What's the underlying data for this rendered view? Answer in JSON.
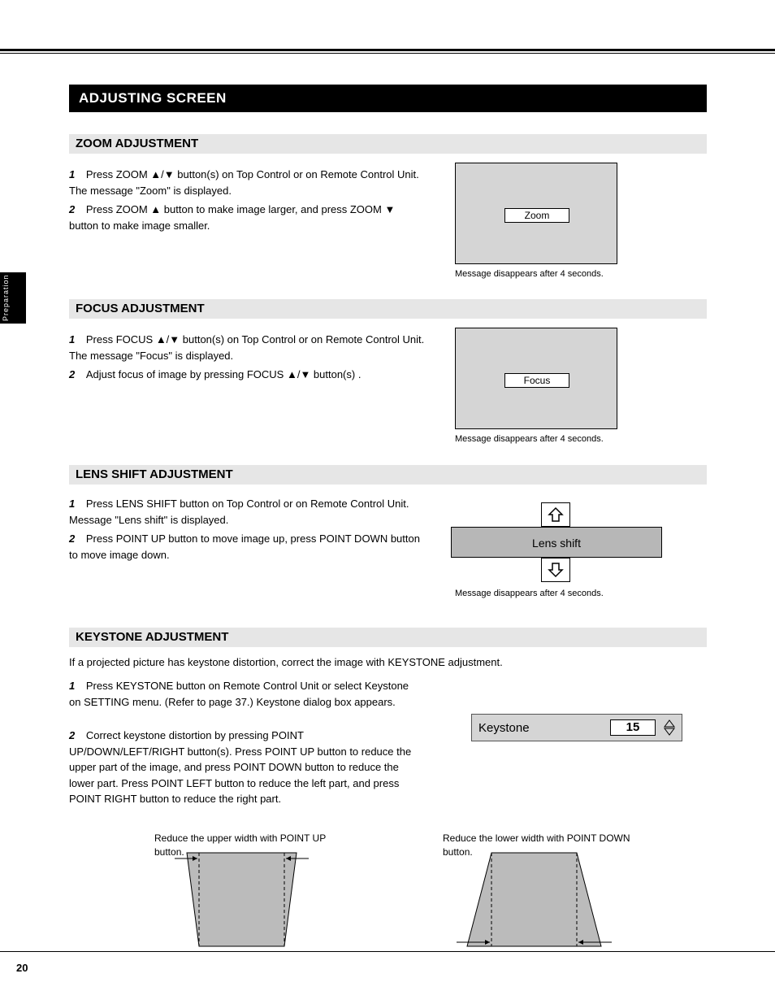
{
  "page_number": "20",
  "sidebar_label": "Preparation",
  "banner": "ADJUSTING SCREEN",
  "sections": {
    "zoom": {
      "title": "ZOOM ADJUSTMENT",
      "body": "Press ZOOM ▲/▼ button(s) on Top Control or on Remote Control Unit.  The message \"Zoom\" is displayed.",
      "body2": "Press ZOOM ▲ button to make image larger, and press ZOOM ▼ button to make image smaller.",
      "box_label": "Zoom",
      "note": "Message disappears after 4 seconds."
    },
    "focus": {
      "title": "FOCUS ADJUSTMENT",
      "body": "Press FOCUS ▲/▼ button(s) on Top Control or on Remote Control Unit.  The message \"Focus\" is displayed.",
      "body2": "Adjust focus of image by pressing FOCUS ▲/▼ button(s) .",
      "box_label": "Focus",
      "note": "Message disappears after 4 seconds."
    },
    "lensshift": {
      "title": "LENS SHIFT ADJUSTMENT",
      "body": "Press LENS SHIFT button on Top Control or on Remote Control Unit.  Message \"Lens shift\" is displayed.",
      "body2": "Press POINT UP button to move image up, press POINT DOWN button to move image down.",
      "bar_label": "Lens shift",
      "note": "Message disappears after 4 seconds."
    },
    "keystone": {
      "title": "KEYSTONE ADJUSTMENT",
      "intro": "If a projected picture has keystone distortion, correct the image with KEYSTONE adjustment.",
      "body": "Press KEYSTONE button on Remote Control Unit or select Keystone on SETTING menu.  (Refer to page 37.)  Keystone dialog box appears.",
      "body2": "Correct keystone distortion by pressing POINT UP/DOWN/LEFT/RIGHT button(s).  Press POINT UP button to reduce the upper part of the image, and press POINT DOWN button to reduce the lower part.  Press POINT LEFT button to reduce the left part, and press POINT RIGHT button to reduce the right part.",
      "dialog_label": "Keystone",
      "dialog_value": "15",
      "left_caption": "Reduce the upper width with POINT UP button.",
      "right_caption": "Reduce the lower width with POINT DOWN button."
    }
  }
}
